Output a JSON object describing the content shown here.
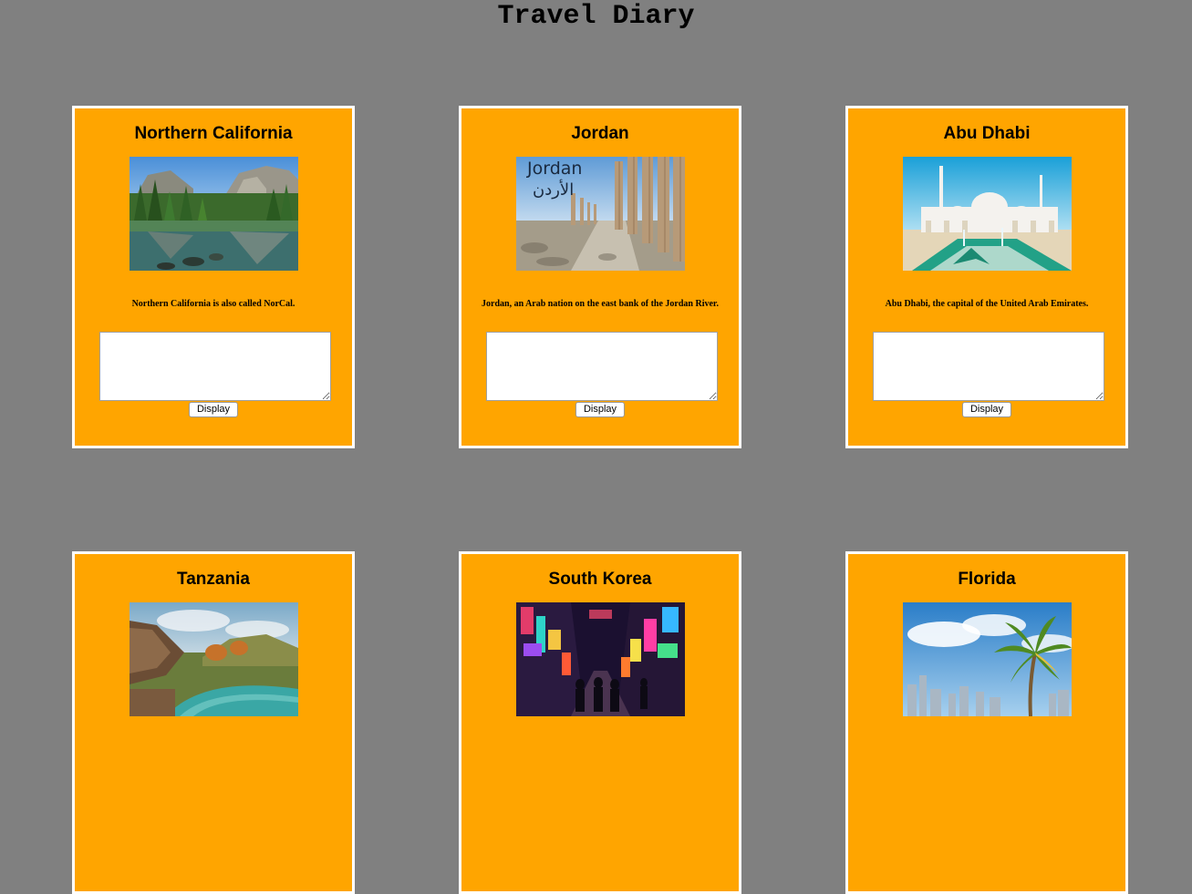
{
  "page": {
    "title": "Travel Diary"
  },
  "cards": [
    {
      "title": "Northern California",
      "image": "yosemite-valley-photo",
      "description": "Northern California is also called NorCal.",
      "note_value": "",
      "button_label": "Display"
    },
    {
      "title": "Jordan",
      "image": "jordan-colonnade-photo",
      "image_caption_en": "Jordan",
      "image_caption_ar": "الأردن",
      "description": "Jordan, an Arab nation on the east bank of the Jordan River.",
      "note_value": "",
      "button_label": "Display"
    },
    {
      "title": "Abu Dhabi",
      "image": "grand-mosque-photo",
      "description": "Abu Dhabi, the capital of the United Arab Emirates.",
      "note_value": "",
      "button_label": "Display"
    },
    {
      "title": "Tanzania",
      "image": "tanzania-lodge-pool-photo"
    },
    {
      "title": "South Korea",
      "image": "seoul-night-street-photo"
    },
    {
      "title": "Florida",
      "image": "miami-skyline-palm-photo"
    }
  ]
}
